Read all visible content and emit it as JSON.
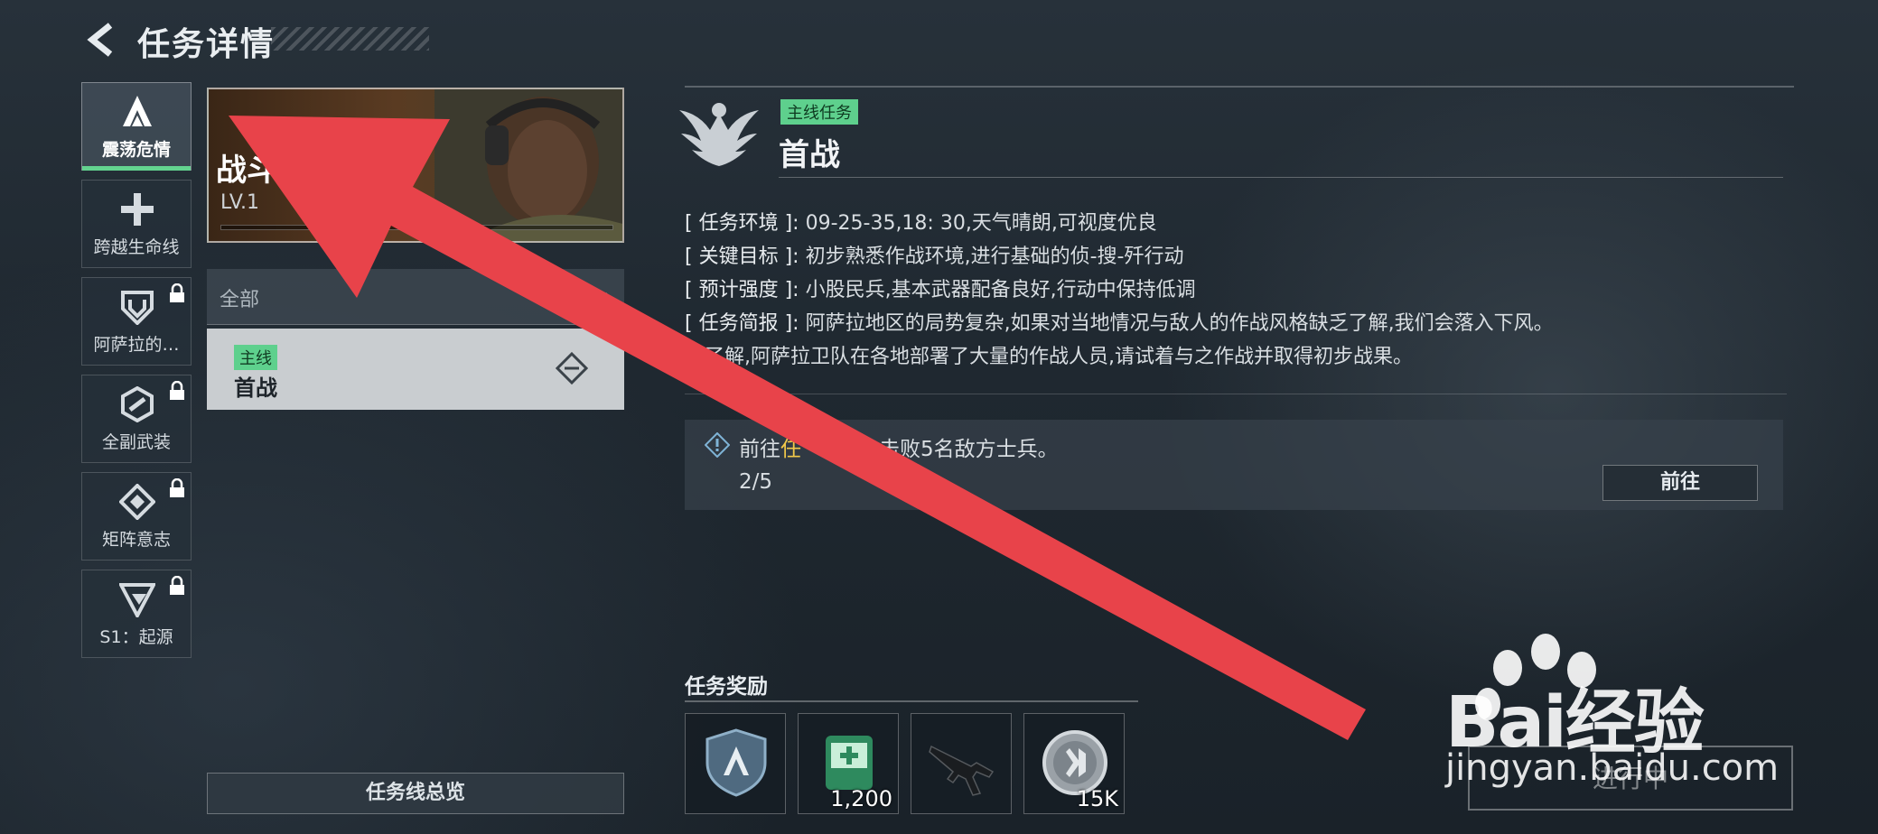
{
  "header": {
    "title": "任务详情",
    "back_icon": "back-arrow-icon"
  },
  "side_tabs": [
    {
      "label": "震荡危情",
      "icon": "a-logo-icon",
      "active": true,
      "locked": false
    },
    {
      "label": "跨越生命线",
      "icon": "cross-icon",
      "active": false,
      "locked": false
    },
    {
      "label": "阿萨拉的…",
      "icon": "shield-emblem-icon",
      "active": false,
      "locked": true
    },
    {
      "label": "全副武装",
      "icon": "hexagon-link-icon",
      "active": false,
      "locked": true
    },
    {
      "label": "矩阵意志",
      "icon": "diamond-matrix-icon",
      "active": false,
      "locked": true
    },
    {
      "label": "S1：起源",
      "icon": "triangle-logo-icon",
      "active": false,
      "locked": true
    }
  ],
  "questline_card": {
    "name": "战斗",
    "level": "LV.1"
  },
  "filter": {
    "label": "全部"
  },
  "quest_list": [
    {
      "tag": "主线",
      "name": "首战"
    }
  ],
  "overview_button": "任务线总览",
  "quest": {
    "tag": "主线任务",
    "title": "首战",
    "info": [
      {
        "key": "[ 任务环境 ]:",
        "value": "09-25-35,18: 30,天气晴朗,可视度优良"
      },
      {
        "key": "[ 关键目标 ]:",
        "value": "初步熟悉作战环境,进行基础的侦-搜-歼行动"
      },
      {
        "key": "[ 预计强度 ]:",
        "value": "小股民兵,基本武器配备良好,行动中保持低调"
      },
      {
        "key": "[ 任务简报 ]:",
        "value": "阿萨拉地区的局势复杂,如果对当地情况与敌人的作战风格缺乏了解,我们会落入下风。"
      }
    ],
    "brief_continued": "握了解,阿萨拉卫队在各地部署了大量的作战人员,请试着与之作战并取得初步战果。",
    "objective": {
      "prefix": "前往",
      "highlight": "任",
      "suffix": "击败5名敌方士兵。",
      "progress": "2/5",
      "button": "前往"
    }
  },
  "rewards": {
    "title": "任务奖励",
    "items": [
      {
        "icon": "a-badge-shield-icon",
        "count": ""
      },
      {
        "icon": "medkit-box-icon",
        "count": "1,200"
      },
      {
        "icon": "rifle-icon",
        "count": ""
      },
      {
        "icon": "coin-icon",
        "count": "15K"
      }
    ]
  },
  "status_button": "进行中",
  "watermark": {
    "brand": "Bai经验",
    "url": "jingyan.baidu.com"
  },
  "annotation": {
    "arrow_color": "#e8434a"
  }
}
